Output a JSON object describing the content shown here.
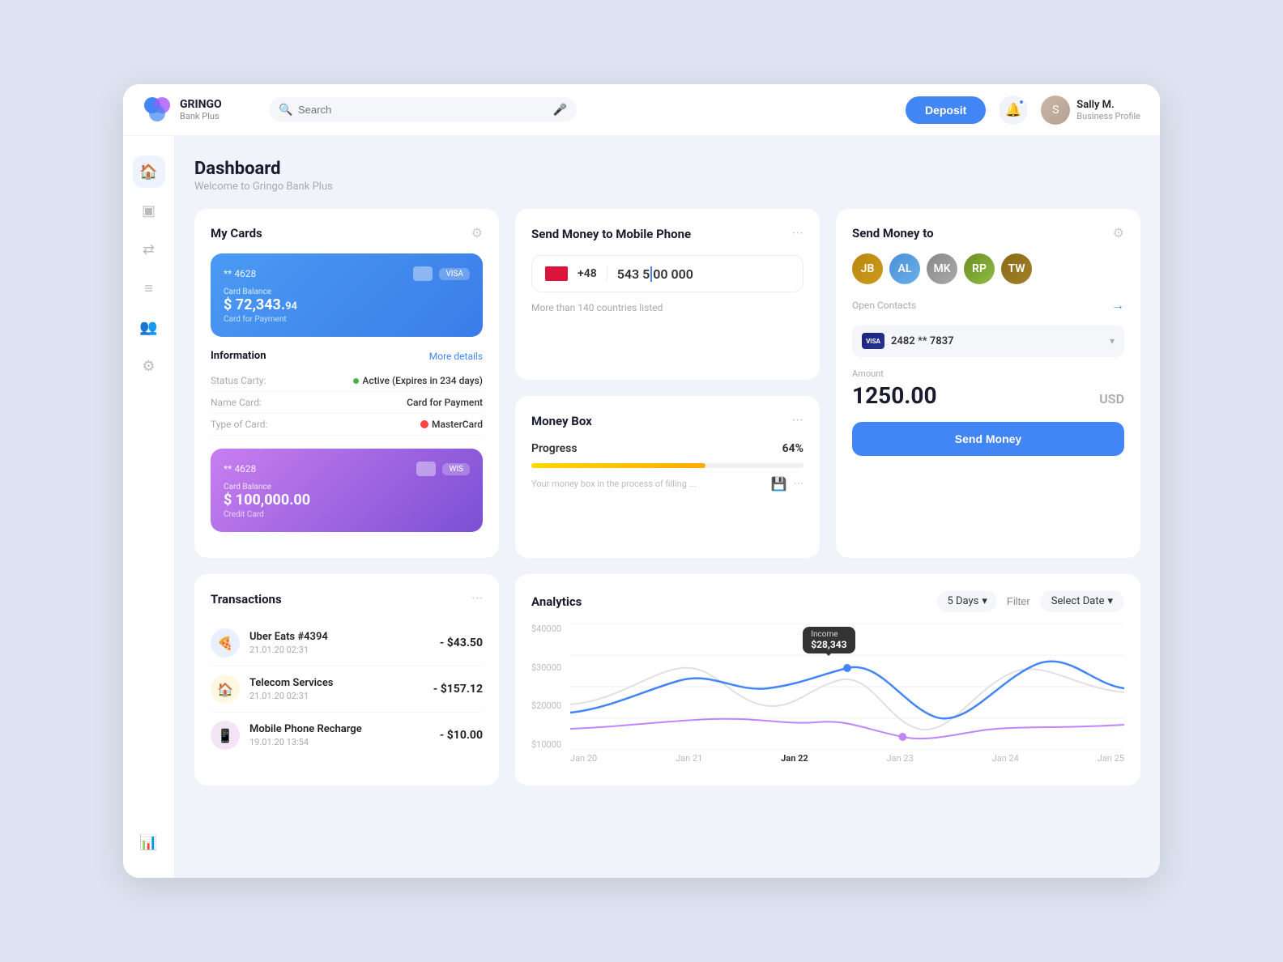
{
  "app": {
    "brand": "GRINGO",
    "sub": "Bank Plus",
    "tagline": "Welcome to Gringo Bank Plus"
  },
  "header": {
    "search_placeholder": "Search",
    "deposit_label": "Deposit",
    "user_name": "Sally M.",
    "user_role": "Business Profile"
  },
  "sidebar": {
    "items": [
      {
        "name": "dashboard",
        "icon": "🏠",
        "active": true
      },
      {
        "name": "cards",
        "icon": "▣",
        "active": false
      },
      {
        "name": "transfers",
        "icon": "⇄",
        "active": false
      },
      {
        "name": "transactions",
        "icon": "≡",
        "active": false
      },
      {
        "name": "contacts",
        "icon": "👥",
        "active": false
      },
      {
        "name": "settings",
        "icon": "◎",
        "active": false
      }
    ]
  },
  "dashboard": {
    "title": "Dashboard",
    "subtitle": "Welcome to Gringo Bank Plus"
  },
  "my_cards": {
    "title": "My Cards",
    "cards": [
      {
        "number": "** 4628",
        "label": "Card for Payment",
        "balance_label": "Card Balance",
        "balance": "$ 72,343.",
        "balance_cents": "94",
        "color": "blue"
      },
      {
        "number": "** 4628",
        "label": "Credit Card",
        "balance_label": "Card Balance",
        "balance": "$ 100,000.00",
        "color": "purple"
      }
    ],
    "information": {
      "title": "Information",
      "more_details": "More details",
      "rows": [
        {
          "label": "Status Carty:",
          "value": "Active (Expires in 234 days)",
          "type": "status"
        },
        {
          "label": "Name Card:",
          "value": "Card for Payment",
          "type": "text"
        },
        {
          "label": "Type of Card:",
          "value": "MasterCard",
          "type": "mc"
        }
      ]
    }
  },
  "transactions": {
    "title": "Transactions",
    "items": [
      {
        "name": "Uber Eats #4394",
        "date": "21.01.20 02:31",
        "amount": "- $43.50",
        "icon": "🍕",
        "color": "blue"
      },
      {
        "name": "Telecom Services",
        "date": "21.01.20 02:31",
        "amount": "- $157.12",
        "icon": "🏠",
        "color": "yellow"
      },
      {
        "name": "Mobile Phone Recharge",
        "date": "19.01.20 13:54",
        "amount": "- $10.00",
        "icon": "📱",
        "color": "purple"
      }
    ]
  },
  "send_mobile": {
    "title": "Send Money to Mobile Phone",
    "country_code": "+48",
    "phone_number": "543 5|00 000",
    "countries_text": "More than 140 countries listed"
  },
  "money_box": {
    "title": "Money Box",
    "progress_label": "Progress",
    "progress_pct": "64%",
    "progress_value": 64,
    "description": "Your money box in the process of filling ..."
  },
  "send_to": {
    "title": "Send Money to",
    "contacts": [
      {
        "id": "c1",
        "initials": "JB"
      },
      {
        "id": "c2",
        "initials": "AL"
      },
      {
        "id": "c3",
        "initials": "MK"
      },
      {
        "id": "c4",
        "initials": "RP"
      },
      {
        "id": "c5",
        "initials": "TW"
      }
    ],
    "open_contacts": "Open Contacts",
    "card_number": "2482 ** 7837",
    "amount_label": "Amount",
    "amount": "1250.00",
    "currency": "USD",
    "send_btn": "Send Money"
  },
  "analytics": {
    "title": "Analytics",
    "days_option": "5 Days",
    "filter_label": "Filter",
    "select_date_label": "Select Date",
    "tooltip": {
      "label": "Income",
      "value": "$28,343"
    },
    "y_labels": [
      "$40000",
      "$30000",
      "$20000",
      "$10000"
    ],
    "x_labels": [
      "Jan 20",
      "Jan 21",
      "Jan 22",
      "Jan 23",
      "Jan 24",
      "Jan 25"
    ],
    "x_bold_index": 2
  }
}
